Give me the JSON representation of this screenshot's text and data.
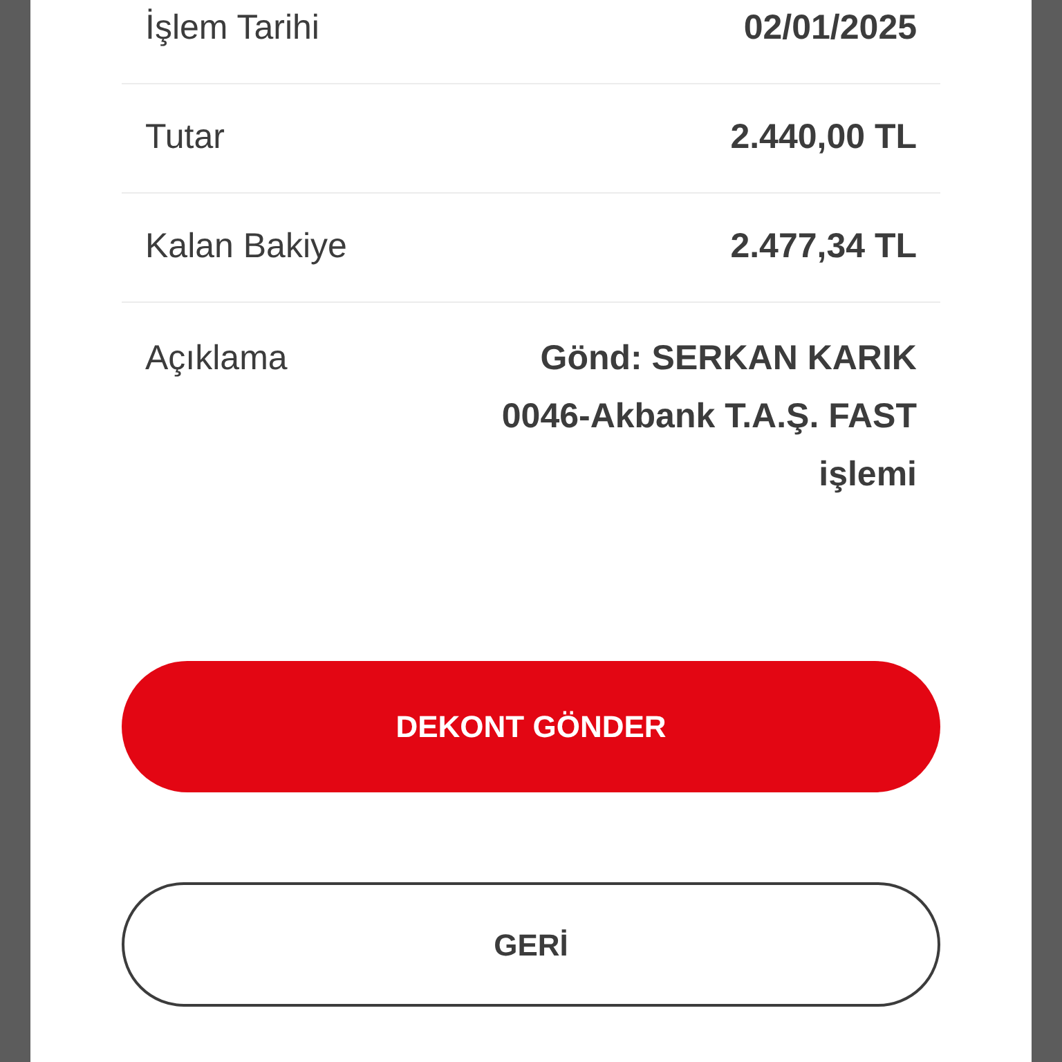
{
  "details": [
    {
      "label": "İşlem Tarihi",
      "value": "02/01/2025"
    },
    {
      "label": "Tutar",
      "value": "2.440,00 TL"
    },
    {
      "label": "Kalan Bakiye",
      "value": "2.477,34 TL"
    }
  ],
  "description": {
    "label": "Açıklama",
    "lines": [
      "Gönd: SERKAN KARIK",
      "0046-Akbank T.A.Ş. FAST",
      "işlemi"
    ]
  },
  "buttons": [
    {
      "label": "DEKONT GÖNDER",
      "kind": "primary"
    },
    {
      "label": "GERİ",
      "kind": "outline"
    }
  ]
}
